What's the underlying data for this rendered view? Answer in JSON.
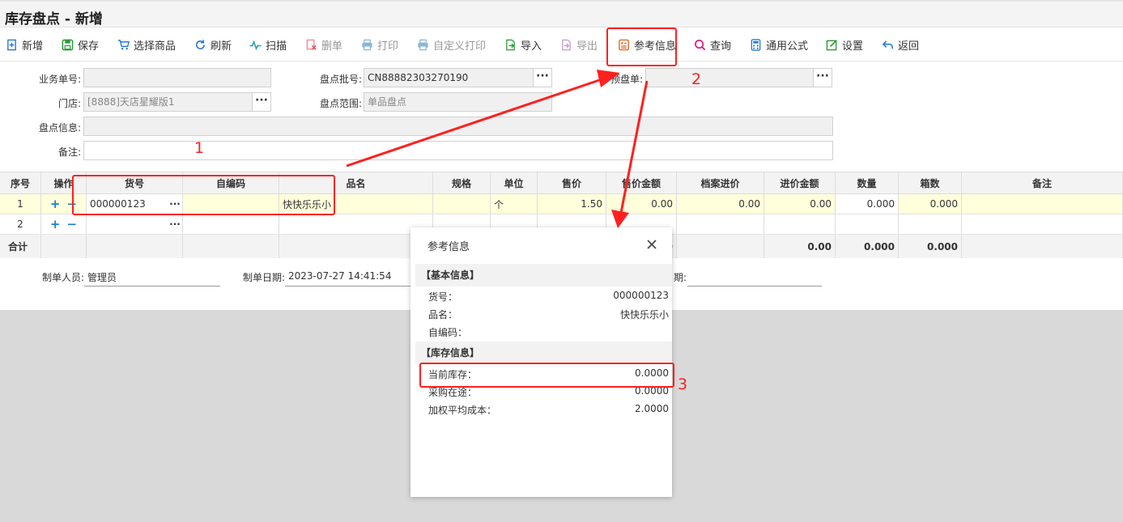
{
  "page": {
    "title": "库存盘点 - 新增"
  },
  "toolbar": {
    "new": "新增",
    "save": "保存",
    "select_goods": "选择商品",
    "refresh": "刷新",
    "scan": "扫描",
    "delete_doc": "删单",
    "print": "打印",
    "custom_print": "自定义打印",
    "import": "导入",
    "export": "导出",
    "reference_info": "参考信息",
    "query": "查询",
    "common_formula": "通用公式",
    "settings": "设置",
    "back": "返回"
  },
  "form": {
    "doc_no_label": "业务单号:",
    "doc_no_value": "",
    "batch_no_label": "盘点批号:",
    "batch_no_value": "CN88882303270190",
    "pre_count_label": "预盘单:",
    "pre_count_value": "",
    "store_label": "门店:",
    "store_value": "[8888]天店星耀版1",
    "scope_label": "盘点范围:",
    "scope_value": "单品盘点",
    "info_label": "盘点信息:",
    "info_value": "",
    "remark_label": "备注:",
    "remark_value": ""
  },
  "grid": {
    "columns": [
      "序号",
      "操作",
      "货号",
      "自编码",
      "品名",
      "规格",
      "单位",
      "售价",
      "售价金额",
      "档案进价",
      "进价金额",
      "数量",
      "箱数",
      "备注"
    ],
    "rows": [
      {
        "seq": "1",
        "code": "000000123",
        "self_code": "",
        "name": "快快乐乐小",
        "spec": "",
        "unit": "个",
        "price": "1.50",
        "price_amount": "0.00",
        "archive_cost": "0.00",
        "cost_amount": "0.00",
        "qty": "0.000",
        "boxes": "0.000",
        "remark": ""
      },
      {
        "seq": "2",
        "code": "",
        "self_code": "",
        "name": "",
        "spec": "",
        "unit": "",
        "price": "",
        "price_amount": "",
        "archive_cost": "",
        "cost_amount": "",
        "qty": "",
        "boxes": "",
        "remark": ""
      }
    ],
    "summary": {
      "label": "合计",
      "price_amount": "0",
      "cost_amount": "0.00",
      "qty": "0.000",
      "boxes": "0.000"
    }
  },
  "footer": {
    "creator_label": "制单人员:",
    "creator_value": "管理员",
    "date_label": "制单日期:",
    "date_value": "2023-07-27 14:41:54",
    "date2_label": "期:",
    "date2_value": ""
  },
  "dialog": {
    "title": "参考信息",
    "basic_section": "【基本信息】",
    "code_label": "货号：",
    "code_value": "000000123",
    "name_label": "品名：",
    "name_value": "快快乐乐小",
    "self_code_label": "自编码：",
    "self_code_value": "",
    "stock_section": "【库存信息】",
    "current_stock_label": "当前库存：",
    "current_stock_value": "0.0000",
    "in_transit_label": "采购在途：",
    "in_transit_value": "0.0000",
    "avg_cost_label": "加权平均成本：",
    "avg_cost_value": "2.0000"
  },
  "annotations": {
    "one": "1",
    "two": "2",
    "three": "3"
  },
  "colors": {
    "annotation_red": "#ff2020",
    "row_highlight": "#ffffdc",
    "plus_blue": "#1e7fd8"
  }
}
